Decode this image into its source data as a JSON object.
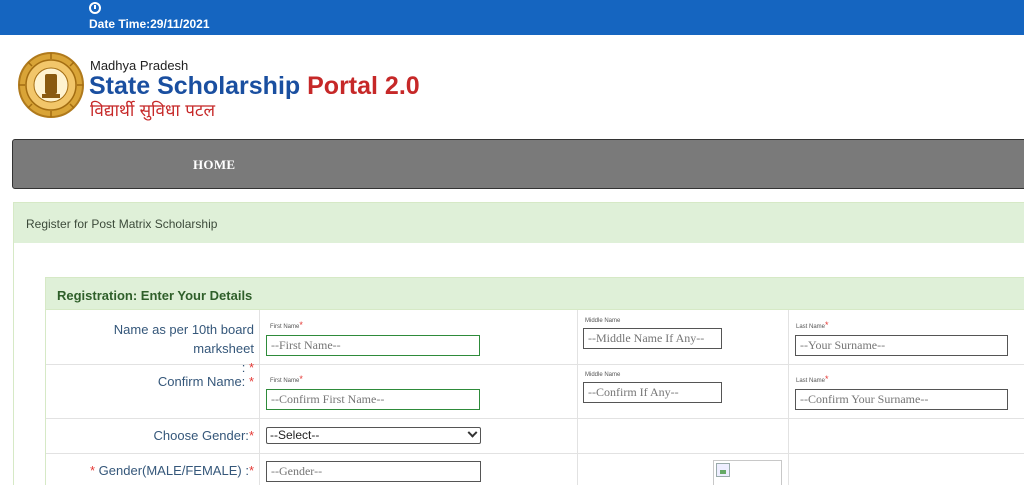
{
  "topbar": {
    "datetime": "Date Time:29/11/2021",
    "icon": "clock-icon"
  },
  "brand": {
    "line1": "Madhya Pradesh",
    "title_blue": "State Scholarship",
    "title_red": "Portal 2.0",
    "hindi": "विद्यार्थी सुविधा पटल",
    "logo_icon": "mp-emblem-logo"
  },
  "nav": {
    "home": "HOME"
  },
  "panel": {
    "heading": "Register for Post Matrix Scholarship"
  },
  "form": {
    "heading": "Registration: Enter Your Details",
    "rows": {
      "name": {
        "label": "Name  as per 10th board marksheet",
        "label_suffix": ":",
        "first_caption": "First Name",
        "first_placeholder": "--First Name--",
        "middle_caption": "Middle Name",
        "middle_placeholder": "--Middle Name If Any--",
        "last_caption": "Last Name",
        "last_placeholder": "--Your Surname--"
      },
      "confirm": {
        "label": "Confirm Name:",
        "first_caption": "First Name",
        "first_placeholder": "--Confirm First Name--",
        "middle_caption": "Middle Name",
        "middle_placeholder": "--Confirm If Any--",
        "last_caption": "Last Name",
        "last_placeholder": "--Confirm Your Surname--"
      },
      "gender": {
        "label": "Choose Gender:",
        "selected": "--Select--"
      },
      "gender_text": {
        "label": "Gender(MALE/FEMALE) :",
        "placeholder": "--Gender--"
      }
    },
    "required_mark": "*"
  },
  "colors": {
    "topbar": "#1565c0",
    "nav": "#7a7a7a",
    "panel_header": "#dff0d8",
    "required": "#e53935",
    "brand_blue": "#1a4fa0",
    "brand_red": "#c62828"
  }
}
